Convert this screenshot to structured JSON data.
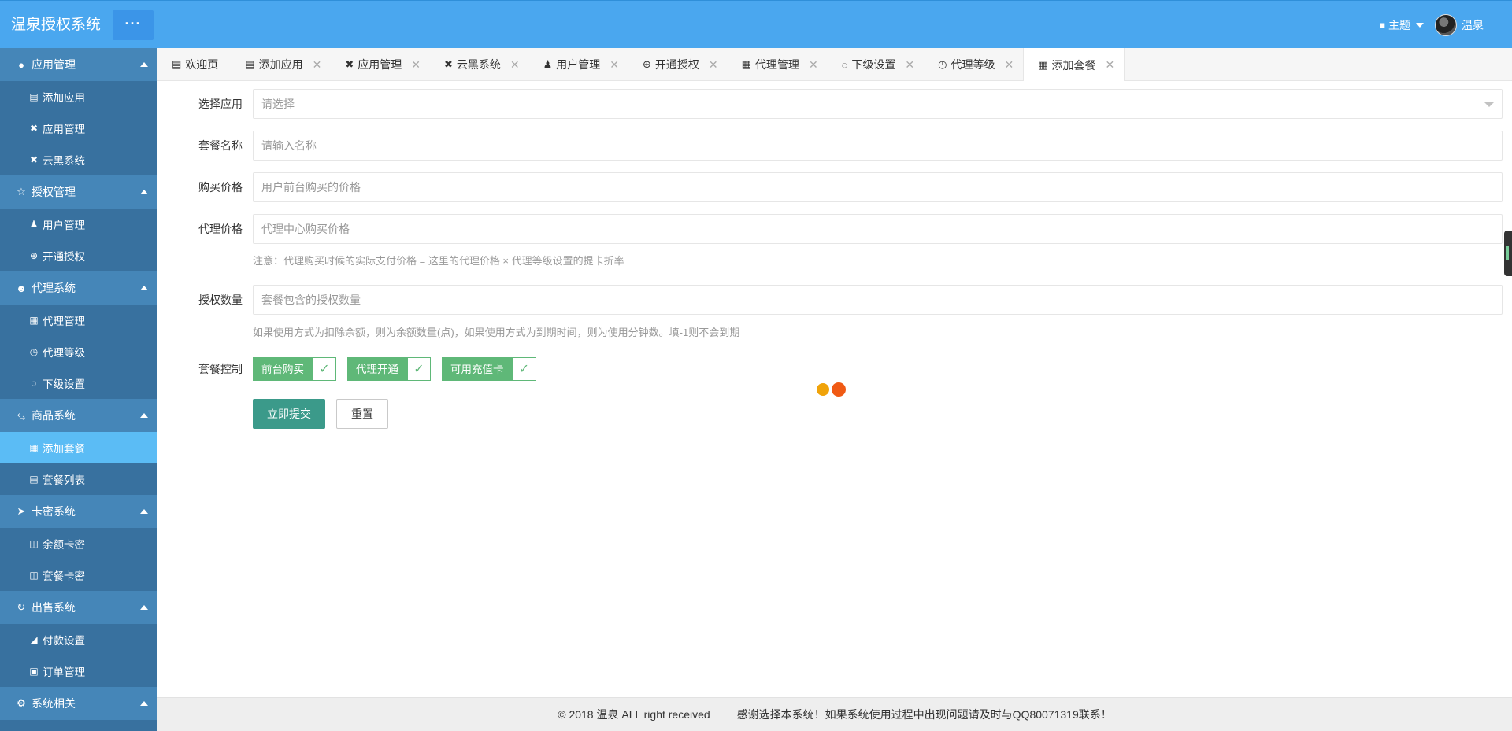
{
  "header": {
    "brand": "温泉授权系统",
    "more_label": "···",
    "theme_label": "主题",
    "user_name": "温泉"
  },
  "sidebar": {
    "groups": [
      {
        "label": "应用管理",
        "icon": "circle-icon",
        "items": [
          {
            "label": "添加应用",
            "icon": "window-icon"
          },
          {
            "label": "应用管理",
            "icon": "tools-icon"
          },
          {
            "label": "云黑系统",
            "icon": "tools-icon"
          }
        ]
      },
      {
        "label": "授权管理",
        "icon": "star-icon",
        "items": [
          {
            "label": "用户管理",
            "icon": "user-icon"
          },
          {
            "label": "开通授权",
            "icon": "plus-circle-icon"
          }
        ]
      },
      {
        "label": "代理系统",
        "icon": "agent-icon",
        "items": [
          {
            "label": "代理管理",
            "icon": "image-icon"
          },
          {
            "label": "代理等级",
            "icon": "clock-icon"
          },
          {
            "label": "下级设置",
            "icon": "drops-icon"
          }
        ]
      },
      {
        "label": "商品系统",
        "icon": "share-icon",
        "items": [
          {
            "label": "添加套餐",
            "icon": "grid-icon",
            "active": true
          },
          {
            "label": "套餐列表",
            "icon": "card-icon"
          }
        ]
      },
      {
        "label": "卡密系统",
        "icon": "send-icon",
        "items": [
          {
            "label": "余额卡密",
            "icon": "apps-icon"
          },
          {
            "label": "套餐卡密",
            "icon": "apps-icon"
          }
        ]
      },
      {
        "label": "出售系统",
        "icon": "refresh-icon",
        "items": [
          {
            "label": "付款设置",
            "icon": "cart-icon"
          },
          {
            "label": "订单管理",
            "icon": "doc-icon"
          }
        ]
      },
      {
        "label": "系统相关",
        "icon": "gear-icon",
        "items": []
      }
    ]
  },
  "tabs": [
    {
      "label": "欢迎页",
      "icon": "window-icon",
      "closable": false
    },
    {
      "label": "添加应用",
      "icon": "window-icon",
      "closable": true
    },
    {
      "label": "应用管理",
      "icon": "tools-icon",
      "closable": true
    },
    {
      "label": "云黑系统",
      "icon": "tools-icon",
      "closable": true
    },
    {
      "label": "用户管理",
      "icon": "user-icon",
      "closable": true
    },
    {
      "label": "开通授权",
      "icon": "plus-circle-icon",
      "closable": true
    },
    {
      "label": "代理管理",
      "icon": "image-icon",
      "closable": true
    },
    {
      "label": "下级设置",
      "icon": "drops-icon",
      "closable": true
    },
    {
      "label": "代理等级",
      "icon": "clock-icon",
      "closable": true
    },
    {
      "label": "添加套餐",
      "icon": "grid-icon",
      "closable": true,
      "active": true
    }
  ],
  "form": {
    "app_label": "选择应用",
    "app_placeholder": "请选择",
    "name_label": "套餐名称",
    "name_placeholder": "请输入名称",
    "buy_price_label": "购买价格",
    "buy_price_placeholder": "用户前台购买的价格",
    "agent_price_label": "代理价格",
    "agent_price_placeholder": "代理中心购买价格",
    "agent_price_hint": "注意：代理购买时候的实际支付价格 = 这里的代理价格 × 代理等级设置的提卡折率",
    "auth_count_label": "授权数量",
    "auth_count_placeholder": "套餐包含的授权数量",
    "auth_count_hint": "如果使用方式为扣除余额，则为余额数量(点)，如果使用方式为到期时间，则为使用分钟数。填-1则不会到期",
    "control_label": "套餐控制",
    "switches": [
      {
        "label": "前台购买",
        "checked": true
      },
      {
        "label": "代理开通",
        "checked": true
      },
      {
        "label": "可用充值卡",
        "checked": true
      }
    ],
    "submit_label": "立即提交",
    "reset_label": "重置"
  },
  "footer": {
    "copyright": "© 2018 温泉 ALL right received",
    "notice": "感谢选择本系统！如果系统使用过程中出现问题请及时与QQ80071319联系！"
  },
  "colors": {
    "header": "#4aa7ef",
    "sidebar": "#38719f",
    "sidebar_group": "#4586b8",
    "sidebar_active": "#5bbcf5",
    "switch_green": "#5fb878",
    "submit": "#3b9a8a"
  }
}
